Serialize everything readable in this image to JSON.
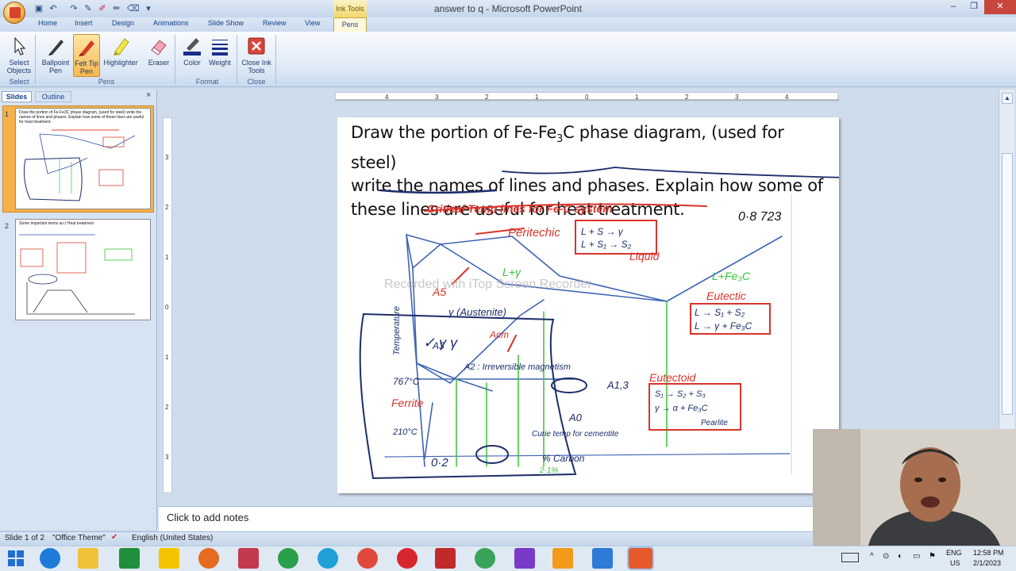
{
  "window": {
    "title": "answer to q  -  Microsoft PowerPoint",
    "contextual_group": "Ink Tools",
    "controls": [
      "–",
      "❐",
      "✕"
    ]
  },
  "ribbon_tabs": [
    "Home",
    "Insert",
    "Design",
    "Animations",
    "Slide Show",
    "Review",
    "View",
    "Pens"
  ],
  "ribbon": {
    "select_objects": "Select Objects",
    "ballpoint_pen": "Ballpoint Pen",
    "felt_tip_pen": "Felt Tip Pen",
    "highlighter": "Highlighter",
    "eraser": "Eraser",
    "color": "Color",
    "weight": "Weight",
    "close_ink_tools": "Close Ink Tools",
    "groups": {
      "select": "Select",
      "pens": "Pens",
      "format": "Format",
      "close": "Close"
    }
  },
  "slides_pane": {
    "tab_slides": "Slides",
    "tab_outline": "Outline",
    "close": "×",
    "thumbs": [
      {
        "number": "1",
        "text": "Draw the portion of Fe-Fe3C phase diagram, (used for steel) write the names of lines and phases. Explain how some of these lines are useful   for heat treatment."
      },
      {
        "number": "2",
        "text": "Some important terms w.r.t Heat treatment"
      }
    ]
  },
  "slide": {
    "heading_line1a": "Draw the portion of Fe-Fe",
    "heading_sub": "3",
    "heading_line1b": "C phase diagram, (used for steel)",
    "heading_line2": "write the names of lines and phases. Explain how some of",
    "heading_line3": "these lines are useful   for heat treatment.",
    "watermark": "Recorded with iTop Screen Recorder"
  },
  "notes": {
    "placeholder": "Click to add notes"
  },
  "status": {
    "slide_count": "Slide 1 of 2",
    "theme": "\"Office Theme\"",
    "language": "English (United States)"
  },
  "taskbar": {
    "lang_line1": "ENG",
    "lang_line2": "US",
    "time": "12:58 PM",
    "date": "2/1/2023"
  },
  "colors": {
    "ribbon_accent": "#f7b84f",
    "ink_tools": "#f3d76b",
    "title_close": "#c9463d",
    "status_bar": "#c4d6ec"
  }
}
